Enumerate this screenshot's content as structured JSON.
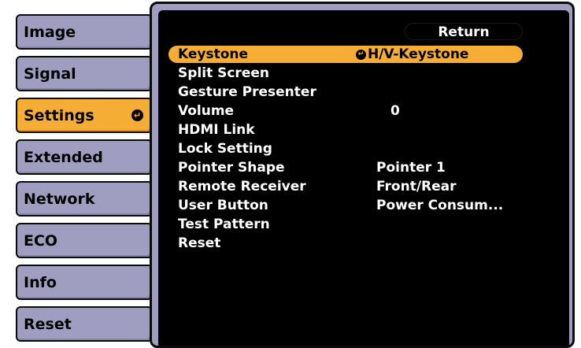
{
  "tabs": [
    {
      "label": "Image",
      "active": false
    },
    {
      "label": "Signal",
      "active": false
    },
    {
      "label": "Settings",
      "active": true
    },
    {
      "label": "Extended",
      "active": false
    },
    {
      "label": "Network",
      "active": false
    },
    {
      "label": "ECO",
      "active": false
    },
    {
      "label": "Info",
      "active": false
    },
    {
      "label": "Reset",
      "active": false
    }
  ],
  "panel": {
    "return_label": "Return",
    "items": [
      {
        "label": "Keystone",
        "value": "H/V-Keystone",
        "selected": true
      },
      {
        "label": "Split Screen",
        "value": ""
      },
      {
        "label": "Gesture Presenter",
        "value": ""
      },
      {
        "label": "Volume",
        "value": "0"
      },
      {
        "label": "HDMI Link",
        "value": ""
      },
      {
        "label": "Lock Setting",
        "value": ""
      },
      {
        "label": "Pointer Shape",
        "value": "Pointer 1"
      },
      {
        "label": "Remote Receiver",
        "value": "Front/Rear"
      },
      {
        "label": "User Button",
        "value": "Power Consum..."
      },
      {
        "label": "Test Pattern",
        "value": ""
      },
      {
        "label": "Reset",
        "value": ""
      }
    ]
  },
  "colors": {
    "tab_bg": "#a09ec0",
    "accent": "#f5ad35",
    "panel_bg": "#000000",
    "text_light": "#ffffff"
  },
  "icons": {
    "enter": "enter-icon"
  }
}
